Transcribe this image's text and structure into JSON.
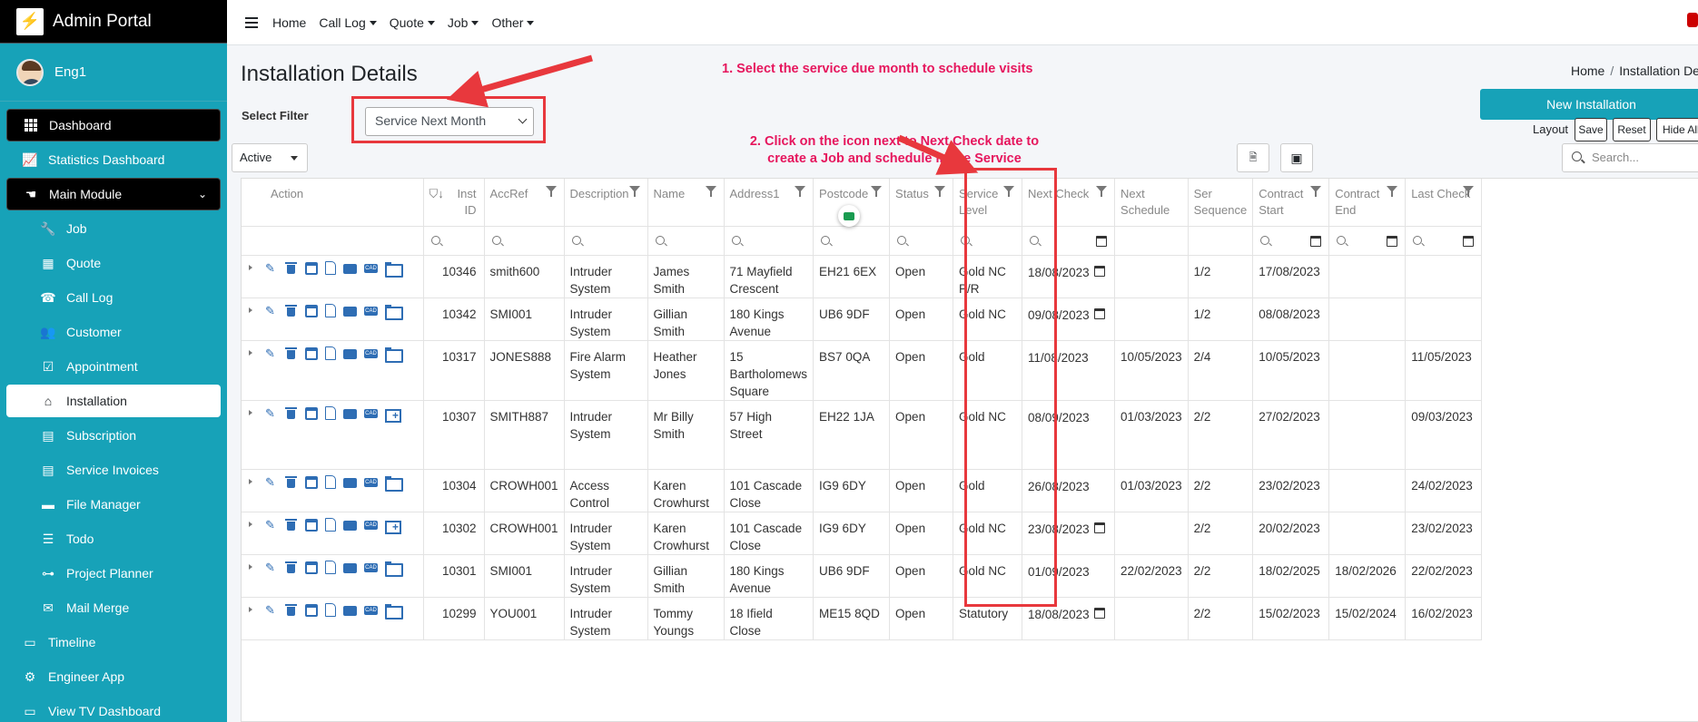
{
  "brand": {
    "title": "Admin Portal",
    "logo": "⚡"
  },
  "user": {
    "name": "Eng1"
  },
  "sidebar": {
    "items": [
      {
        "label": "Dashboard",
        "icon": "grid-icon",
        "style": "dark"
      },
      {
        "label": "Statistics Dashboard",
        "icon": "chart-icon"
      },
      {
        "label": "Main Module",
        "icon": "hand-icon",
        "style": "dark",
        "expanded": true
      },
      {
        "label": "Job",
        "icon": "wrench-icon",
        "sub": true
      },
      {
        "label": "Quote",
        "icon": "calculator-icon",
        "sub": true
      },
      {
        "label": "Call Log",
        "icon": "user-phone-icon",
        "sub": true
      },
      {
        "label": "Customer",
        "icon": "users-icon",
        "sub": true
      },
      {
        "label": "Appointment",
        "icon": "calendar-check-icon",
        "sub": true
      },
      {
        "label": "Installation",
        "icon": "home-icon",
        "sub": true,
        "active": true
      },
      {
        "label": "Subscription",
        "icon": "doc-icon",
        "sub": true
      },
      {
        "label": "Service Invoices",
        "icon": "invoice-icon",
        "sub": true
      },
      {
        "label": "File Manager",
        "icon": "folder-icon",
        "sub": true
      },
      {
        "label": "Todo",
        "icon": "list-icon",
        "sub": true
      },
      {
        "label": "Project Planner",
        "icon": "sitemap-icon",
        "sub": true
      },
      {
        "label": "Mail Merge",
        "icon": "mail-merge-icon",
        "sub": true
      },
      {
        "label": "Timeline",
        "icon": "timeline-icon"
      },
      {
        "label": "Engineer App",
        "icon": "user-gear-icon"
      },
      {
        "label": "View TV Dashboard",
        "icon": "tv-icon"
      }
    ]
  },
  "topnav": {
    "home": "Home",
    "menus": [
      "Call Log",
      "Quote",
      "Job",
      "Other"
    ]
  },
  "page": {
    "title": "Installation Details",
    "breadcrumb_home": "Home",
    "breadcrumb_current": "Installation Details",
    "filter_label": "Select Filter",
    "filter_value": "Service Next Month",
    "status_value": "Active",
    "new_button": "New Installation",
    "layout_label": "Layout",
    "layout_save": "Save",
    "layout_reset": "Reset",
    "layout_hide": "Hide All",
    "search_placeholder": "Search..."
  },
  "annotations": {
    "note1": "1. Select the service due month to schedule visits",
    "note2_line1": "2. Click on the icon next to Next Check date to",
    "note2_line2": "create a Job and schedule in the Service"
  },
  "table": {
    "headers": {
      "action": "Action",
      "inst_id_1": "Inst",
      "inst_id_2": "ID",
      "accref": "AccRef",
      "description": "Description",
      "name": "Name",
      "address1": "Address1",
      "postcode": "Postcode",
      "status": "Status",
      "service_level_1": "Service",
      "service_level_2": "Level",
      "next_check": "Next Check",
      "next_schedule_1": "Next",
      "next_schedule_2": "Schedule",
      "ser_sequence_1": "Ser",
      "ser_sequence_2": "Sequence",
      "contract_start_1": "Contract",
      "contract_start_2": "Start",
      "contract_end_1": "Contract",
      "contract_end_2": "End",
      "last_check": "Last Check"
    },
    "rows": [
      {
        "id": "10346",
        "accref": "smith600",
        "desc": "Intruder System",
        "name": "James Smith",
        "addr": "71 Mayfield Crescent",
        "postcode": "EH21 6EX",
        "status": "Open",
        "level": "Gold NC P/R",
        "next_check": "18/08/2023",
        "cal": true,
        "next_sched": "",
        "seq": "1/2",
        "cstart": "17/08/2023",
        "cend": "",
        "last": "",
        "last_icon": "folder"
      },
      {
        "id": "10342",
        "accref": "SMI001",
        "desc": "Intruder System",
        "name": "Gillian Smith",
        "addr": "180 Kings Avenue",
        "postcode": "UB6 9DF",
        "status": "Open",
        "level": "Gold NC",
        "next_check": "09/08/2023",
        "cal": true,
        "next_sched": "",
        "seq": "1/2",
        "cstart": "08/08/2023",
        "cend": "",
        "last": "",
        "last_icon": "folder"
      },
      {
        "id": "10317",
        "accref": "JONES888",
        "desc": "Fire Alarm System",
        "name": "Heather Jones",
        "addr": "15 Bartholomews Square",
        "postcode": "BS7 0QA",
        "status": "Open",
        "level": "Gold",
        "next_check": "11/08/2023",
        "cal": false,
        "next_sched": "10/05/2023",
        "seq": "2/4",
        "cstart": "10/05/2023",
        "cend": "",
        "last": "11/05/2023",
        "last_icon": "folder"
      },
      {
        "id": "10307",
        "accref": "SMITH887",
        "desc": "Intruder System",
        "name": "Mr Billy Smith",
        "addr": "57 High Street",
        "postcode": "EH22 1JA",
        "status": "Open",
        "level": "Gold NC",
        "next_check": "08/09/2023",
        "cal": false,
        "next_sched": "01/03/2023",
        "seq": "2/2",
        "cstart": "27/02/2023",
        "cend": "",
        "last": "09/03/2023",
        "last_icon": "folder-plus"
      },
      {
        "id": "10304",
        "accref": "CROWH001",
        "desc": "Access Control",
        "name": "Karen Crowhurst",
        "addr": "101 Cascade Close",
        "postcode": "IG9 6DY",
        "status": "Open",
        "level": "Gold",
        "next_check": "26/08/2023",
        "cal": false,
        "next_sched": "01/03/2023",
        "seq": "2/2",
        "cstart": "23/02/2023",
        "cend": "",
        "last": "24/02/2023",
        "last_icon": "folder"
      },
      {
        "id": "10302",
        "accref": "CROWH001",
        "desc": "Intruder System",
        "name": "Karen Crowhurst",
        "addr": "101 Cascade Close",
        "postcode": "IG9 6DY",
        "status": "Open",
        "level": "Gold NC",
        "next_check": "23/08/2023",
        "cal": true,
        "next_sched": "",
        "seq": "2/2",
        "cstart": "20/02/2023",
        "cend": "",
        "last": "23/02/2023",
        "last_icon": "folder-plus"
      },
      {
        "id": "10301",
        "accref": "SMI001",
        "desc": "Intruder System",
        "name": "Gillian Smith",
        "addr": "180 Kings Avenue",
        "postcode": "UB6 9DF",
        "status": "Open",
        "level": "Gold NC",
        "next_check": "01/09/2023",
        "cal": false,
        "next_sched": "22/02/2023",
        "seq": "2/2",
        "cstart": "18/02/2025",
        "cend": "18/02/2026",
        "last": "22/02/2023",
        "last_icon": "folder"
      },
      {
        "id": "10299",
        "accref": "YOU001",
        "desc": "Intruder System",
        "name": "Tommy Youngs",
        "addr": "18 Ifield Close",
        "postcode": "ME15 8QD",
        "status": "Open",
        "level": "Statutory",
        "next_check": "18/08/2023",
        "cal": true,
        "next_sched": "",
        "seq": "2/2",
        "cstart": "15/02/2023",
        "cend": "15/02/2024",
        "last": "16/02/2023",
        "last_icon": "folder"
      }
    ]
  },
  "colors": {
    "sidebar": "#17a2b8",
    "annotation": "#e6165d",
    "highlight": "#e8383d",
    "action_icons": "#2e6db4"
  }
}
